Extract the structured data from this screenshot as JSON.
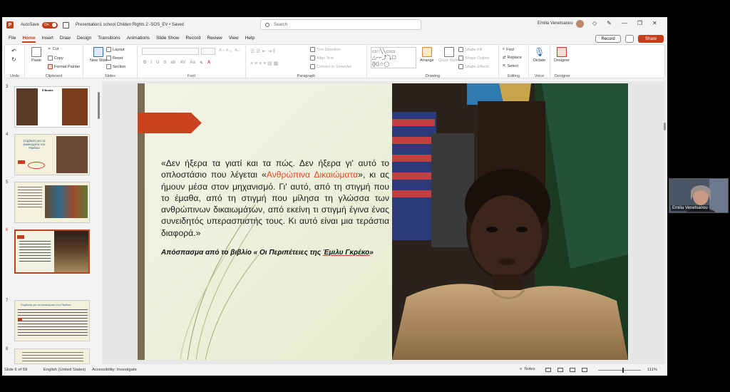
{
  "titlebar": {
    "autosave_label": "AutoSave",
    "autosave_state": "On",
    "document_name": "Presentation1 school Childen Rights 2 -SOS_EV • Saved",
    "search_placeholder": "Search",
    "user_name": "Emilia Venetsanou"
  },
  "menu": {
    "items": [
      "File",
      "Home",
      "Insert",
      "Draw",
      "Design",
      "Transitions",
      "Animations",
      "Slide Show",
      "Record",
      "Review",
      "View",
      "Help"
    ],
    "active": "Home",
    "record_label": "Record",
    "share_label": "Share"
  },
  "ribbon": {
    "groups": {
      "undo": "Undo",
      "clipboard": "Clipboard",
      "slides": "Slides",
      "font": "Font",
      "paragraph": "Paragraph",
      "drawing": "Drawing",
      "editing": "Editing",
      "voice": "Voice",
      "designer": "Designer"
    },
    "buttons": {
      "paste": "Paste",
      "cut": "Cut",
      "copy": "Copy",
      "format_painter": "Format Painter",
      "new_slide": "New Slide",
      "layout": "Layout",
      "reset": "Reset",
      "section": "Section",
      "text_direction": "Text Direction",
      "align_text": "Align Text",
      "convert_smartart": "Convert to SmartArt",
      "arrange": "Arrange",
      "quick_styles": "Quick Styles",
      "shape_fill": "Shape Fill",
      "shape_outline": "Shape Outline",
      "shape_effects": "Shape Effects",
      "find": "Find",
      "replace": "Replace",
      "select": "Select",
      "dictate": "Dictate",
      "designer": "Designer"
    },
    "font_format": [
      "B",
      "I",
      "U",
      "S",
      "ab",
      "AV",
      "Aa"
    ]
  },
  "thumbnails": [
    {
      "num": "3",
      "title": "5 Books"
    },
    {
      "num": "4",
      "title": "Σύμβαση για τα Δικαιώματα του Παιδιού"
    },
    {
      "num": "5",
      "title": ""
    },
    {
      "num": "6",
      "title": "",
      "selected": true
    },
    {
      "num": "7",
      "title": "Σύμβαση για τα Δικαιώματα του Παιδιού"
    },
    {
      "num": "8",
      "title": ""
    }
  ],
  "slide": {
    "quote_part1": "«Δεν ήξερα τα γιατί και τα πώς. Δεν ήξερα γι' αυτό το οπλοστάσιο που λέγεται «",
    "quote_highlight": "Ανθρώπινα Δικαιώματα",
    "quote_part2": "», κι ας ήμουν μέσα στον μηχανισμό. Γι' αυτό, από τη στιγμή που το έμαθα, από τη στιγμή που μίλησα τη γλώσσα των ανθρώπινων δικαιωμάτων, από εκείνη τι στιγμή έγινα ένας συνειδητός υπερασπιστής τους. Κι αυτό είναι μια τεράστια διαφορά.»",
    "caption_part1": "Απόσπασμα από το βιβλίο « Οι Περιπέτειες της ",
    "caption_ul": "Έμιλυ Γκρέκο",
    "caption_part2": "»"
  },
  "statusbar": {
    "slide_info": "Slide 6 of 59",
    "language": "English (United States)",
    "accessibility": "Accessibility: Investigate",
    "notes": "Notes",
    "zoom": "111%"
  },
  "video": {
    "participant": "Emilia Venetsanou"
  },
  "colors": {
    "accent": "#c43e1c",
    "highlight_text": "#e04a2a"
  }
}
